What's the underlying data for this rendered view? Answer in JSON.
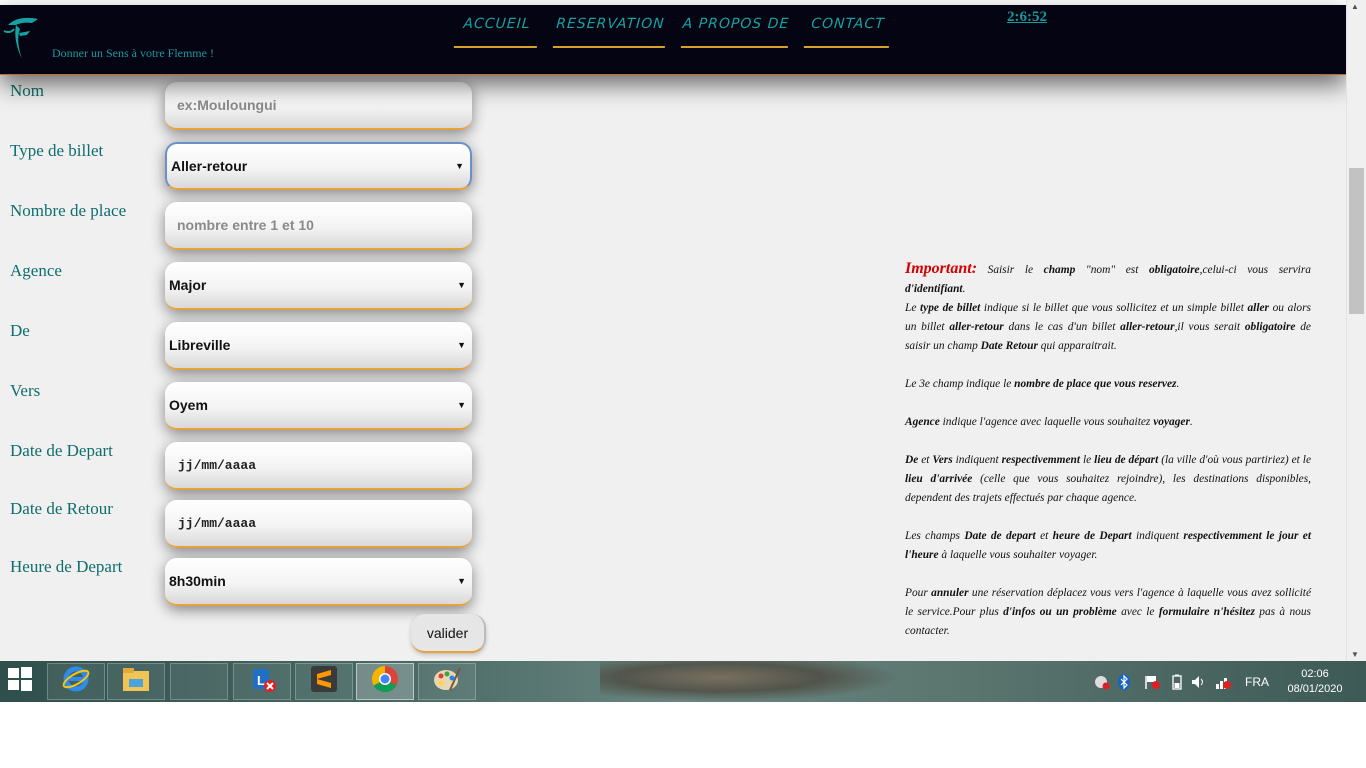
{
  "header": {
    "slogan": "Donner un Sens à votre Flemme !",
    "nav": [
      "ACCUEIL",
      "RESERVATION",
      "A PROPOS DE",
      "CONTACT"
    ],
    "clock": "2:6:52"
  },
  "form": {
    "labels": {
      "nom": "Nom",
      "type_billet": "Type de billet",
      "nombre_place": "Nombre de place",
      "agence": "Agence",
      "de": "De",
      "vers": "Vers",
      "date_depart": "Date de Depart",
      "date_retour": "Date de Retour",
      "heure_depart": "Heure de Depart"
    },
    "nom_placeholder": "ex:Mouloungui",
    "type_billet_value": "Aller-retour",
    "nombre_place_placeholder": "nombre entre 1 et 10",
    "agence_value": "Major",
    "de_value": "Libreville",
    "vers_value": "Oyem",
    "date_depart_placeholder": "jj/mm/aaaa",
    "date_retour_placeholder": "jj/mm/aaaa",
    "heure_depart_value": "8h30min",
    "submit_label": "valider"
  },
  "info": {
    "important_label": "Important:",
    "p1_a": " Saisir le ",
    "p1_b": "champ",
    "p1_c": " \"nom\" est ",
    "p1_d": "obligatoire",
    "p1_e": ",celui-ci vous servira ",
    "p1_f": "d'identifiant",
    "p1_g": ".",
    "p2_a": "Le ",
    "p2_b": "type de billet",
    "p2_c": " indique si le billet que vous sollicitez et un simple billet ",
    "p2_d": "aller",
    "p2_e": " ou alors un billet ",
    "p2_f": "aller-retour",
    "p2_g": " dans le cas d'un billet ",
    "p2_h": "aller-retour",
    "p2_i": ",il vous serait ",
    "p2_j": "obligatoire",
    "p2_k": " de saisir un champ ",
    "p2_l": "Date Retour",
    "p2_m": " qui apparaitrait.",
    "p3_a": "Le 3e champ indique le ",
    "p3_b": "nombre de place que vous reservez",
    "p3_c": ".",
    "p4_a": "Agence",
    "p4_b": " indique l'agence avec laquelle vous souhaitez ",
    "p4_c": "voyager",
    "p4_d": ".",
    "p5_a": "De",
    "p5_b": " et ",
    "p5_c": "Vers",
    "p5_d": " indiquent ",
    "p5_e": "respectivemment",
    "p5_f": " le ",
    "p5_g": "lieu de départ",
    "p5_h": " (la ville d'où vous partiriez) et le ",
    "p5_i": "lieu d'arrivée",
    "p5_j": " (celle que vous souhaitez rejoindre), les destinations disponibles, dependent des trajets effectués par chaque agence.",
    "p6_a": "Les champs ",
    "p6_b": "Date de depart",
    "p6_c": " et ",
    "p6_d": "heure de Depart",
    "p6_e": " indiquent ",
    "p6_f": "respectivemment le jour et l'heure",
    "p6_g": " à laquelle vous souhaiter voyager.",
    "p7_a": "Pour ",
    "p7_b": "annuler",
    "p7_c": " une réservation déplacez vous vers l'agence à laquelle vous avez sollicité le service.Pour plus ",
    "p7_d": "d'infos ou un problème",
    "p7_e": " avec le ",
    "p7_f": "formulaire n'hésitez",
    "p7_g": " pas à nous contacter."
  },
  "taskbar": {
    "apps": [
      "internet-explorer",
      "file-explorer",
      "blank-window",
      "lync",
      "sublime-text",
      "chrome",
      "paint"
    ],
    "language": "FRA",
    "time": "02:06",
    "date": "08/01/2020"
  },
  "colors": {
    "accent": "#15a2a2",
    "nav_bg": "#040412",
    "underline": "#d9a030",
    "important": "#d40000"
  }
}
